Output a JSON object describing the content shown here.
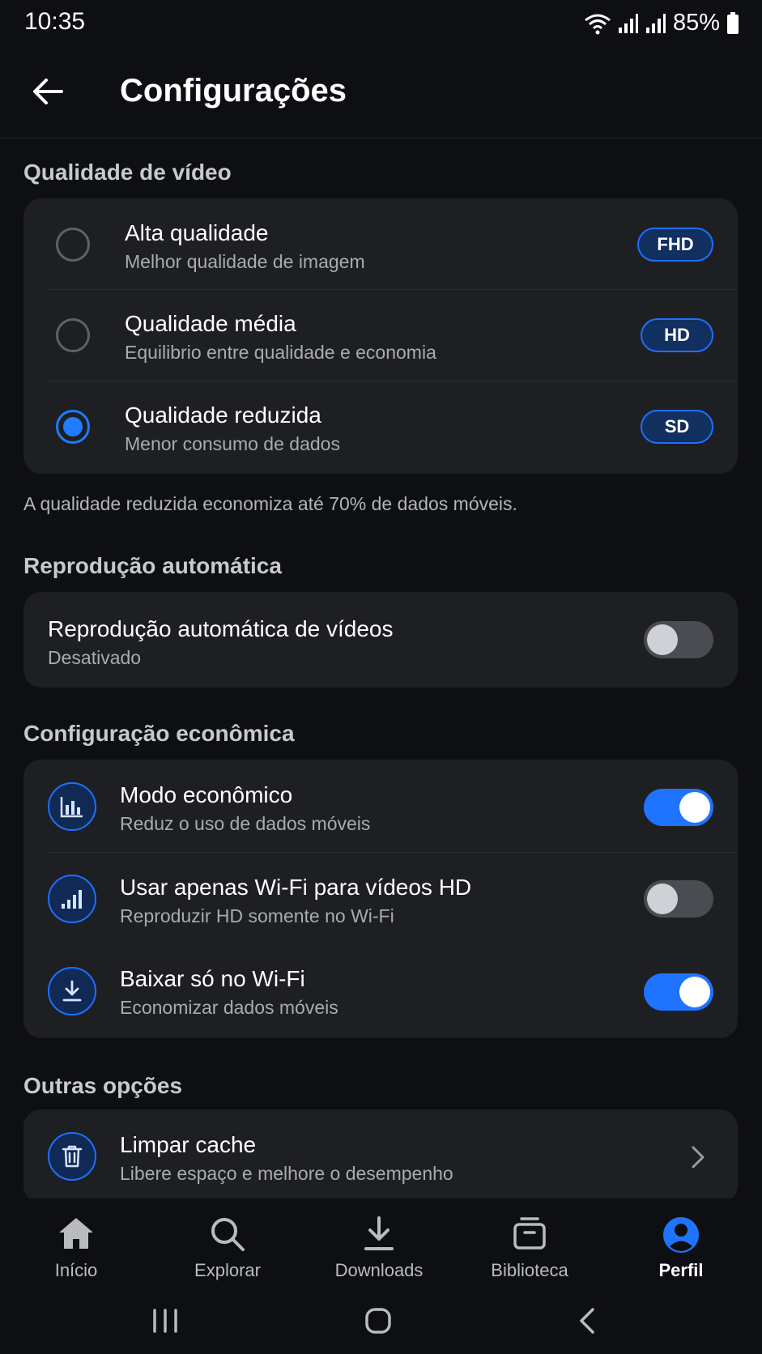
{
  "status_bar": {
    "time": "10:35",
    "battery": "85%"
  },
  "app_bar": {
    "title": "Configurações"
  },
  "video_quality": {
    "section_title": "Qualidade de vídeo",
    "options": [
      {
        "title": "Alta qualidade",
        "subtitle": "Melhor qualidade de imagem",
        "badge": "FHD",
        "selected": false
      },
      {
        "title": "Qualidade média",
        "subtitle": "Equilibrio entre qualidade e economia",
        "badge": "HD",
        "selected": false
      },
      {
        "title": "Qualidade reduzida",
        "subtitle": "Menor consumo de dados",
        "badge": "SD",
        "selected": true
      }
    ],
    "note": "A qualidade reduzida economiza até 70% de dados móveis."
  },
  "autoplay": {
    "section_title": "Reprodução automática",
    "title": "Reprodução automática de vídeos",
    "subtitle": "Desativado",
    "enabled": false
  },
  "economy": {
    "section_title": "Configuração econômica",
    "items": [
      {
        "icon": "bar-chart-icon",
        "title": "Modo econômico",
        "subtitle": "Reduz o uso de dados móveis",
        "enabled": true
      },
      {
        "icon": "signal-icon",
        "title": "Usar apenas Wi-Fi para vídeos HD",
        "subtitle": "Reproduzir HD somente no Wi-Fi",
        "enabled": false
      },
      {
        "icon": "download-icon",
        "title": "Baixar só no Wi-Fi",
        "subtitle": "Economizar dados móveis",
        "enabled": true
      }
    ]
  },
  "other": {
    "section_title": "Outras opções",
    "clear_cache": {
      "icon": "trash-icon",
      "title": "Limpar cache",
      "subtitle": "Libere espaço e melhore o desempenho"
    }
  },
  "bottom_nav": {
    "items": [
      {
        "icon": "home-icon",
        "label": "Início",
        "active": false
      },
      {
        "icon": "search-icon",
        "label": "Explorar",
        "active": false
      },
      {
        "icon": "download-icon",
        "label": "Downloads",
        "active": false
      },
      {
        "icon": "library-icon",
        "label": "Biblioteca",
        "active": false
      },
      {
        "icon": "profile-icon",
        "label": "Perfil",
        "active": true
      }
    ]
  },
  "colors": {
    "accent": "#1f74ff",
    "background": "#0e0f12",
    "card": "#1e1f23"
  }
}
